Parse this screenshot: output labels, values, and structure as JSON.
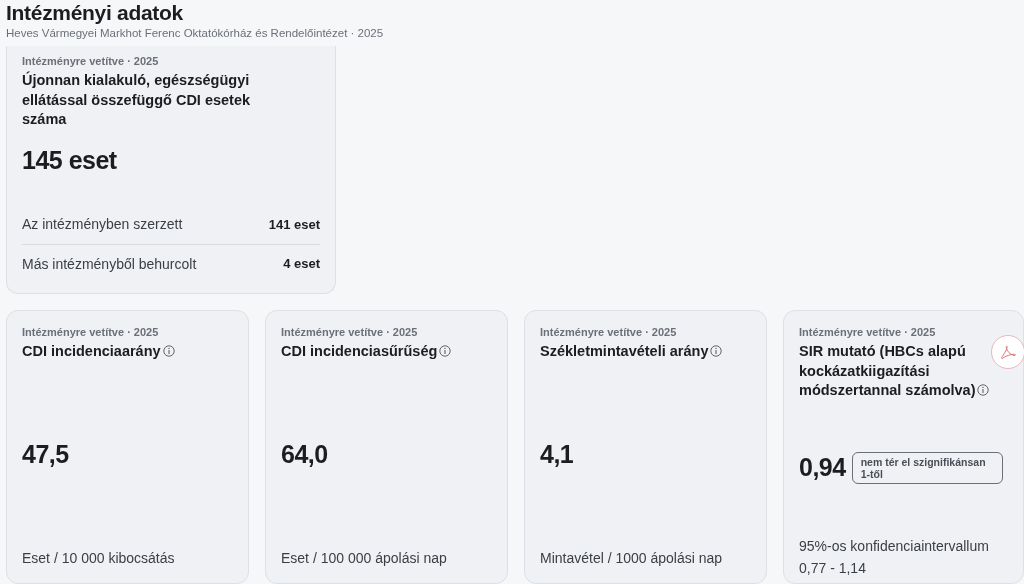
{
  "header": {
    "title": "Intézményi adatok",
    "subtitle": "Heves Vármegyei Markhot Ferenc Oktatókórház és Rendelőintézet · 2025"
  },
  "main_card": {
    "eyebrow": "Intézményre vetítve · 2025",
    "title": "Újonnan kialakuló, egészségügyi ellátással összefüggő CDI esetek száma",
    "value": "145 eset",
    "rows": [
      {
        "label": "Az intézményben szerzett",
        "value": "141 eset"
      },
      {
        "label": "Más intézményből behurcolt",
        "value": "4 eset"
      }
    ]
  },
  "metric_cards": [
    {
      "eyebrow": "Intézményre vetítve · 2025",
      "title": "CDI incidenciaarány",
      "info": true,
      "value": "47,5",
      "footer": "Eset / 10 000 kibocsátás"
    },
    {
      "eyebrow": "Intézményre vetítve · 2025",
      "title": "CDI incidenciasűrűség",
      "info": true,
      "value": "64,0",
      "footer": "Eset / 100 000 ápolási nap"
    },
    {
      "eyebrow": "Intézményre vetítve · 2025",
      "title": "Székletmintavételi arány",
      "info": true,
      "value": "4,1",
      "footer": "Mintavétel / 1000 ápolási nap"
    },
    {
      "eyebrow": "Intézményre vetítve · 2025",
      "title": "SIR mutató (HBCs alapú kockázatkiigazítási módszertannal számolva)",
      "info": true,
      "pdf_button": true,
      "value": "0,94",
      "note": "nem tér el szignifikánsan 1-től",
      "footer": "95%-os konfidenciaintervallum 0,77 - 1,14"
    }
  ]
}
